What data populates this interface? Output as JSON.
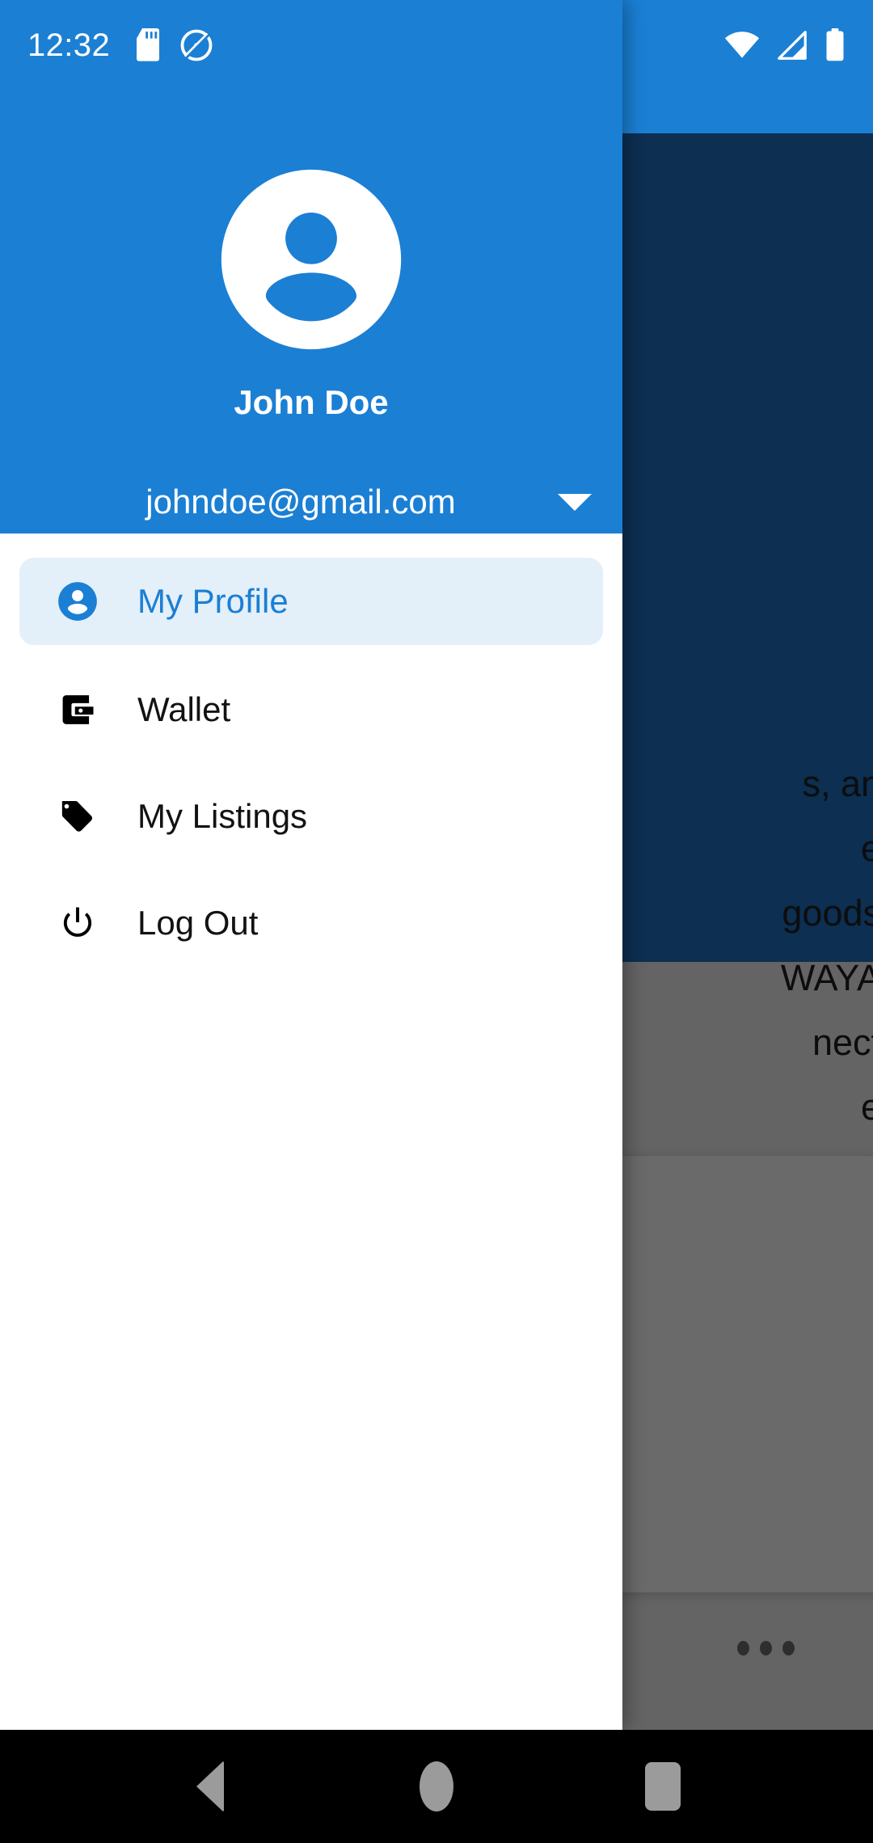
{
  "status_bar": {
    "time": "12:32",
    "icons": [
      "sd-card-icon",
      "location-disabled-icon",
      "wifi-icon",
      "cellular-signal-icon",
      "battery-full-icon"
    ]
  },
  "drawer": {
    "header": {
      "avatar_icon": "account-circle-icon",
      "name": "John Doe",
      "email": "johndoe@gmail.com",
      "expand_icon": "caret-down-icon"
    },
    "items": [
      {
        "label": "My Profile",
        "icon": "account-circle-icon",
        "selected": true
      },
      {
        "label": "Wallet",
        "icon": "wallet-icon",
        "selected": false
      },
      {
        "label": "My Listings",
        "icon": "price-tag-icon",
        "selected": false
      },
      {
        "label": "Log Out",
        "icon": "power-icon",
        "selected": false
      }
    ]
  },
  "background": {
    "partial_text": "s, an\ne\ngoods\nWAYA\nnect\ne\nof",
    "overflow_indicator": "..."
  },
  "navigation_bar": {
    "back": "back-button",
    "home": "home-button",
    "recents": "recents-button"
  },
  "colors": {
    "brand_blue": "#1b7fd4",
    "selected_item_bg": "#e3eff9",
    "drawer_bg": "#ffffff",
    "scrim_grey": "#646464",
    "appbar_dim_navy": "#0c2f52",
    "navbar_black": "#000000"
  }
}
